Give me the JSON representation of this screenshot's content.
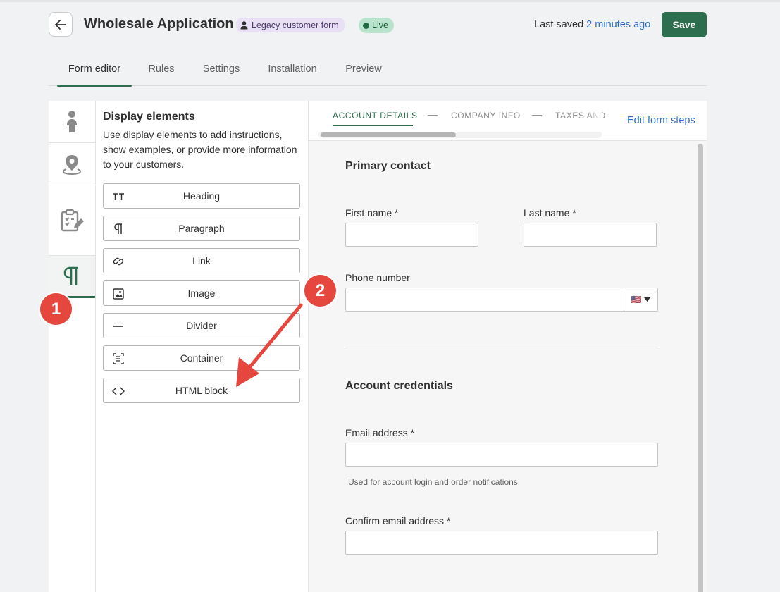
{
  "header": {
    "title": "Wholesale Application",
    "legacy_badge": "Legacy customer form",
    "status_badge": "Live",
    "last_saved_prefix": "Last saved",
    "last_saved_time": "2 minutes ago",
    "save_label": "Save"
  },
  "tabs": [
    "Form editor",
    "Rules",
    "Settings",
    "Installation",
    "Preview"
  ],
  "rail": {
    "items": [
      "person-icon",
      "location-pin-icon",
      "clipboard-edit-icon",
      "paragraph-icon"
    ],
    "active": "paragraph-icon"
  },
  "palette": {
    "title": "Display elements",
    "description": "Use display elements to add instructions, show examples, or provide more information to your customers.",
    "items": [
      {
        "label": "Heading",
        "icon": "heading-icon"
      },
      {
        "label": "Paragraph",
        "icon": "paragraph-icon"
      },
      {
        "label": "Link",
        "icon": "link-icon"
      },
      {
        "label": "Image",
        "icon": "image-icon"
      },
      {
        "label": "Divider",
        "icon": "divider-icon"
      },
      {
        "label": "Container",
        "icon": "container-icon"
      },
      {
        "label": "HTML block",
        "icon": "code-icon"
      }
    ]
  },
  "steps": {
    "items": [
      "ACCOUNT DETAILS",
      "COMPANY INFO",
      "TAXES AND"
    ],
    "active": "ACCOUNT DETAILS",
    "edit_label": "Edit form steps"
  },
  "form": {
    "primary_contact": "Primary contact",
    "first_name": "First name *",
    "last_name": "Last name *",
    "phone_number": "Phone number",
    "phone_flag": "🇺🇸",
    "account_credentials": "Account credentials",
    "email": "Email address *",
    "email_hint": "Used for account login and order notifications",
    "confirm_email": "Confirm email address *"
  },
  "annotations": {
    "marker_1": "1",
    "marker_2": "2"
  },
  "colors": {
    "accent": "#2d6e4e",
    "link": "#2c6ecb",
    "marker": "#e5463d"
  }
}
